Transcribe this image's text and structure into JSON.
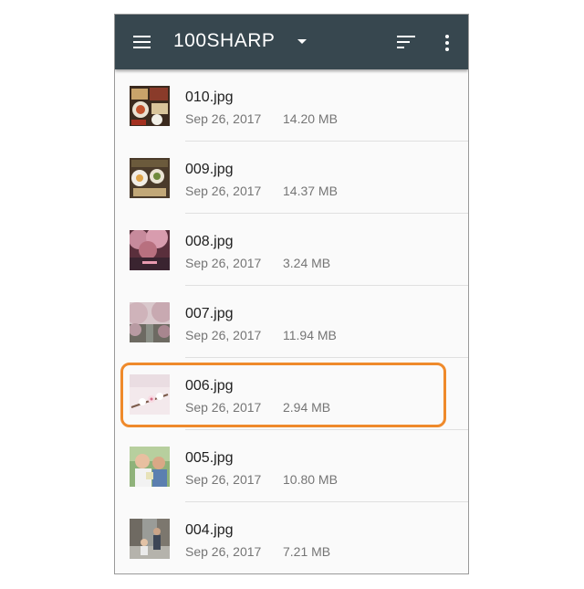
{
  "appbar": {
    "title": "100SHARP",
    "menu_icon": "menu-icon",
    "dropdown_icon": "caret-down-icon",
    "sort_icon": "sort-icon",
    "more_icon": "more-vertical-icon",
    "background": "#37474f"
  },
  "files": [
    {
      "name": "010.jpg",
      "date": "Sep 26, 2017",
      "size": "14.20 MB",
      "thumb": "food-photo"
    },
    {
      "name": "009.jpg",
      "date": "Sep 26, 2017",
      "size": "14.37 MB",
      "thumb": "food-photo"
    },
    {
      "name": "008.jpg",
      "date": "Sep 26, 2017",
      "size": "3.24 MB",
      "thumb": "cherry-blossom-night-photo"
    },
    {
      "name": "007.jpg",
      "date": "Sep 26, 2017",
      "size": "11.94 MB",
      "thumb": "cherry-blossom-river-photo"
    },
    {
      "name": "006.jpg",
      "date": "Sep 26, 2017",
      "size": "2.94 MB",
      "thumb": "cherry-blossom-closeup-photo",
      "highlighted": true
    },
    {
      "name": "005.jpg",
      "date": "Sep 26, 2017",
      "size": "10.80 MB",
      "thumb": "child-photo"
    },
    {
      "name": "004.jpg",
      "date": "Sep 26, 2017",
      "size": "7.21 MB",
      "thumb": "child-street-photo"
    }
  ],
  "colors": {
    "highlight": "#ef8a2b",
    "primary_text": "#212121",
    "secondary_text": "#757575"
  }
}
